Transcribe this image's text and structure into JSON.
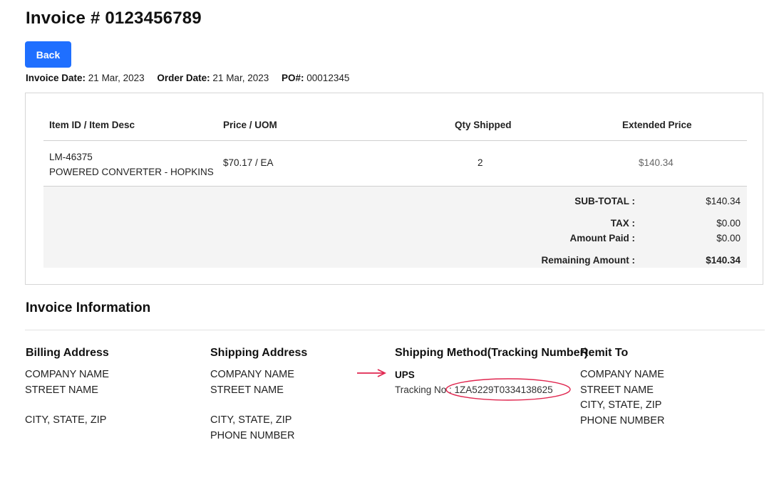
{
  "header": {
    "title": "Invoice # 0123456789",
    "back_label": "Back"
  },
  "meta": {
    "invoice_date_label": "Invoice Date:",
    "invoice_date": "21 Mar, 2023",
    "order_date_label": "Order Date:",
    "order_date": "21 Mar, 2023",
    "po_label": "PO#:",
    "po": "00012345"
  },
  "table": {
    "columns": [
      "Item ID / Item Desc",
      "Price / UOM",
      "Qty Shipped",
      "Extended Price"
    ],
    "rows": [
      {
        "item_id": "LM-46375",
        "item_desc": "POWERED CONVERTER - HOPKINS",
        "price_uom": "$70.17 / EA",
        "qty": "2",
        "extended": "$140.34"
      }
    ]
  },
  "totals": {
    "subtotal_label": "SUB-TOTAL :",
    "subtotal": "$140.34",
    "tax_label": "TAX :",
    "tax": "$0.00",
    "paid_label": "Amount Paid :",
    "paid": "$0.00",
    "remaining_label": "Remaining Amount :",
    "remaining": "$140.34"
  },
  "info": {
    "title": "Invoice Information",
    "billing": {
      "heading": "Billing Address",
      "company": "COMPANY NAME",
      "street": "STREET NAME",
      "city": "CITY, STATE, ZIP"
    },
    "shipping": {
      "heading": "Shipping Address",
      "company": "COMPANY NAME",
      "street": "STREET NAME",
      "city": "CITY, STATE, ZIP",
      "phone": "PHONE NUMBER"
    },
    "method": {
      "heading": "Shipping Method(Tracking Number)",
      "carrier": "UPS",
      "tracking_label": "Tracking No :",
      "tracking_number": "1ZA5229T0334138625"
    },
    "remit": {
      "heading": "Remit To",
      "company": "COMPANY NAME",
      "street": "STREET NAME",
      "city": "CITY, STATE, ZIP",
      "phone": "PHONE NUMBER"
    }
  },
  "annotation_color": "#e0264f"
}
